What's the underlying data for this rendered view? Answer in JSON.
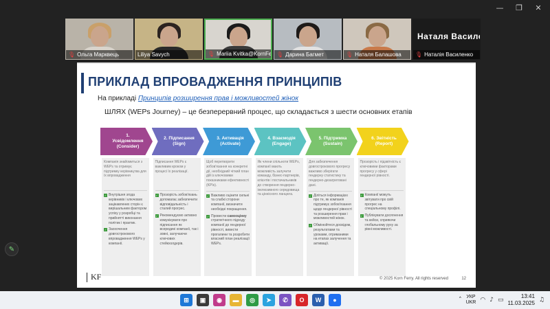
{
  "window_controls": {
    "minimize": "—",
    "restore": "❐",
    "close": "✕"
  },
  "participants": [
    {
      "name": "Ольга Марквець",
      "muted": true,
      "hair": "#c9a06a",
      "clothes": "#d9d4cc",
      "bg": "#b9b3a8",
      "active": false
    },
    {
      "name": "Liliya Savych",
      "muted": false,
      "hair": "#2b2320",
      "clothes": "#2a2a2a",
      "bg": "#c6b486",
      "active": false
    },
    {
      "name": "Mariia Kvitka@KornFerry...",
      "muted": true,
      "hair": "#1b1b1b",
      "clothes": "#3a3a3a",
      "bg": "#d8d5cf",
      "active": true
    },
    {
      "name": "Дарина Багмет",
      "muted": true,
      "hair": "#1e1a18",
      "clothes": "#e2e2e2",
      "bg": "#b7bcc1",
      "active": false
    },
    {
      "name": "Наталя Балашова",
      "muted": true,
      "hair": "#8a6a45",
      "clothes": "#c97a4a",
      "bg": "#cfc7bc",
      "active": false
    },
    {
      "name": "Наталія Василенко",
      "big_name": "Наталя Василе...",
      "muted": true
    }
  ],
  "slide": {
    "title": "ПРИКЛАД ВПРОВАДЖЕННЯ ПРИНЦИПІВ",
    "subtitle_prefix": "На прикладі ",
    "subtitle_link": "Принципів розширення прав і можливостей жінок",
    "journey": "ШЛЯХ (WEPs Journey) – це безперервний процес, що складається з шести основних етапів",
    "stages": [
      {
        "label": "1. Усвідомлення (Consider)",
        "color": "#a0468f"
      },
      {
        "label": "2. Підписання (Sign)",
        "color": "#6f6dbf"
      },
      {
        "label": "3. Активація (Activate)",
        "color": "#3e9ad6"
      },
      {
        "label": "4. Взаємодія (Engage)",
        "color": "#5cc3c2"
      },
      {
        "label": "5. Підтримка (Sustain)",
        "color": "#7bc46e"
      },
      {
        "label": "6. Звітність (Report)",
        "color": "#f2d21c"
      }
    ],
    "columns": [
      {
        "intro": "Компанія знайомиться з WEPs та отримує підтримку керівництва для їх впровадження",
        "items": [
          "Внутрішня згода керівників і ключових зацікавлених сторін є вирішальним фактором успіху у розробці та прийнятті виконання політик і практик.",
          "Заохочення довгострокового впровадження WEPs у компанії."
        ]
      },
      {
        "intro": "Підписання WEPs є важливим кроком у процесі їх реалізації.",
        "items": [
          "Прозорість зобов'язань допомагає забезпечити відповідальність і сталий прогрес.",
          "Рекомендуємо активно комунікувати про підписання як всередині компанії, так і зовні, залучаючи ключових стейкхолдерів."
        ]
      },
      {
        "intro": "Щоб перетворити зобов'язання на конкретні дії, необхідний чіткий план дій із ключовими показниками ефективності (KPIs).",
        "items": [
          "Важливо оцінити сильні та слабкі сторони компанії, визначити необхідні покращення.",
          "Провести самооцінку стратегічного підходу компанії до гендерної рівності, вивести прогалини та розробити власний план реалізації WEPs."
        ]
      },
      {
        "intro": "Як члени спільноти WEPs, компанії мають можливість залучити команду, бізнес-партнерів, клієнтів і постачальників до створення гендерно-інклюзивного середовища та ціннісного ланцюга.",
        "items": []
      },
      {
        "intro": "Для забезпечення довгострокового прогресу важливо зберігати гендерну статистику та гендерно-дезагреговані дані.",
        "items": [
          "Діліться інформацією про те, як компанія підтримує зобов'язання щодо гендерної рівності та розширення прав і можливостей жінок.",
          "Обмінюйтеся досвідом, результатами та уроками, отриманими на етапах залучення та активації."
        ]
      },
      {
        "intro": "Прозорість і підзвітність є ключовими факторами прогресу у сфері гендерної рівності.",
        "items": [
          "Компанії можуть звітувати про свій прогрес на спеціальному профілі.",
          "Публікувати досягнення та кейси, сприяючи глобальному руху за рівні можливості."
        ]
      }
    ],
    "logo": "KF",
    "footer": "© 2025 Korn Ferry.  All rights reserved",
    "page_number": "12"
  },
  "pen_icon": "✎",
  "taskbar": {
    "apps": [
      {
        "name": "windows-start-icon",
        "glyph": "⊞",
        "color": "#1e78d7"
      },
      {
        "name": "task-view-icon",
        "glyph": "▣",
        "color": "#3a3a3a"
      },
      {
        "name": "widgets-icon",
        "glyph": "◉",
        "color": "#c03b8b"
      },
      {
        "name": "explorer-icon",
        "glyph": "▬",
        "color": "#e7b534"
      },
      {
        "name": "chrome-icon",
        "glyph": "◎",
        "color": "#2f9b46"
      },
      {
        "name": "telegram-icon",
        "glyph": "➤",
        "color": "#2aa3df"
      },
      {
        "name": "viber-icon",
        "glyph": "✆",
        "color": "#7b53c2"
      },
      {
        "name": "opera-icon",
        "glyph": "O",
        "color": "#d7262a"
      },
      {
        "name": "word-icon",
        "glyph": "W",
        "color": "#2b5fae"
      },
      {
        "name": "zoom-icon",
        "glyph": "●",
        "color": "#1f6ff0"
      }
    ],
    "lang_top": "УКР",
    "lang_bottom": "UKR",
    "time": "13:41",
    "date": "11.03.2025"
  }
}
